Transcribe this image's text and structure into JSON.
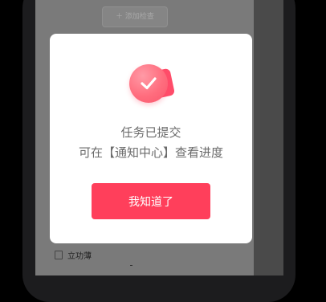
{
  "background": {
    "add_button_label": "＋ 添加检查",
    "bottom_item_label": "立功薄"
  },
  "dialog": {
    "icon": "check-badge-icon",
    "title": "任务已提交",
    "subtitle": "可在【通知中心】查看进度",
    "confirm_label": "我知道了",
    "accent_color": "#ff3f5b"
  }
}
